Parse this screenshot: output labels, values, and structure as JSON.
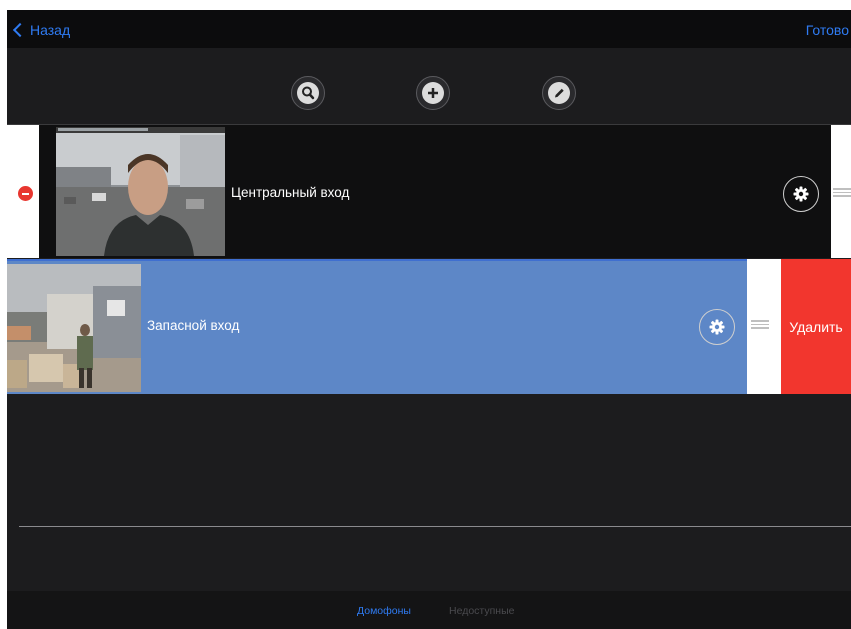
{
  "navbar": {
    "back_label": "Назад",
    "done_label": "Готово"
  },
  "toolbar": {
    "buttons": [
      "search-icon",
      "plus-icon",
      "pencil-icon"
    ]
  },
  "rows": [
    {
      "label": "Центральный вход",
      "thumbnail": "camera-view-face"
    },
    {
      "label": "Запасной вход",
      "thumbnail": "camera-view-yard",
      "delete_label": "Удалить"
    }
  ],
  "tabs": [
    {
      "label": "Домофоны",
      "active": true
    },
    {
      "label": "Недоступные",
      "active": false
    }
  ],
  "colors": {
    "accent": "#2f7bf2",
    "selected_row": "#5d87c7",
    "delete": "#f2362e",
    "minus": "#e8362f"
  }
}
